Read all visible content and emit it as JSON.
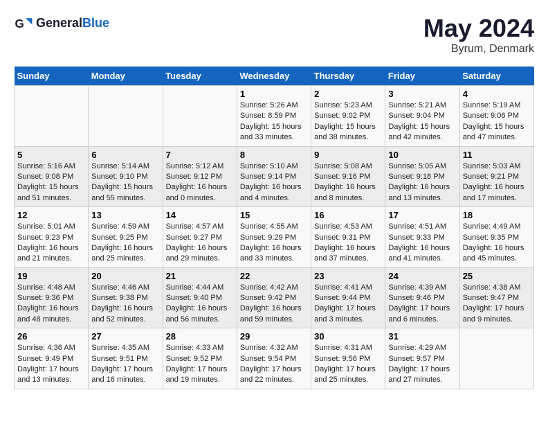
{
  "header": {
    "logo_text_general": "General",
    "logo_text_blue": "Blue",
    "main_title": "May 2024",
    "subtitle": "Byrum, Denmark"
  },
  "days_of_week": [
    "Sunday",
    "Monday",
    "Tuesday",
    "Wednesday",
    "Thursday",
    "Friday",
    "Saturday"
  ],
  "weeks": [
    [
      {
        "day": "",
        "info": ""
      },
      {
        "day": "",
        "info": ""
      },
      {
        "day": "",
        "info": ""
      },
      {
        "day": "1",
        "info": "Sunrise: 5:26 AM\nSunset: 8:59 PM\nDaylight: 15 hours and 33 minutes."
      },
      {
        "day": "2",
        "info": "Sunrise: 5:23 AM\nSunset: 9:02 PM\nDaylight: 15 hours and 38 minutes."
      },
      {
        "day": "3",
        "info": "Sunrise: 5:21 AM\nSunset: 9:04 PM\nDaylight: 15 hours and 42 minutes."
      },
      {
        "day": "4",
        "info": "Sunrise: 5:19 AM\nSunset: 9:06 PM\nDaylight: 15 hours and 47 minutes."
      }
    ],
    [
      {
        "day": "5",
        "info": "Sunrise: 5:16 AM\nSunset: 9:08 PM\nDaylight: 15 hours and 51 minutes."
      },
      {
        "day": "6",
        "info": "Sunrise: 5:14 AM\nSunset: 9:10 PM\nDaylight: 15 hours and 55 minutes."
      },
      {
        "day": "7",
        "info": "Sunrise: 5:12 AM\nSunset: 9:12 PM\nDaylight: 16 hours and 0 minutes."
      },
      {
        "day": "8",
        "info": "Sunrise: 5:10 AM\nSunset: 9:14 PM\nDaylight: 16 hours and 4 minutes."
      },
      {
        "day": "9",
        "info": "Sunrise: 5:08 AM\nSunset: 9:16 PM\nDaylight: 16 hours and 8 minutes."
      },
      {
        "day": "10",
        "info": "Sunrise: 5:05 AM\nSunset: 9:18 PM\nDaylight: 16 hours and 13 minutes."
      },
      {
        "day": "11",
        "info": "Sunrise: 5:03 AM\nSunset: 9:21 PM\nDaylight: 16 hours and 17 minutes."
      }
    ],
    [
      {
        "day": "12",
        "info": "Sunrise: 5:01 AM\nSunset: 9:23 PM\nDaylight: 16 hours and 21 minutes."
      },
      {
        "day": "13",
        "info": "Sunrise: 4:59 AM\nSunset: 9:25 PM\nDaylight: 16 hours and 25 minutes."
      },
      {
        "day": "14",
        "info": "Sunrise: 4:57 AM\nSunset: 9:27 PM\nDaylight: 16 hours and 29 minutes."
      },
      {
        "day": "15",
        "info": "Sunrise: 4:55 AM\nSunset: 9:29 PM\nDaylight: 16 hours and 33 minutes."
      },
      {
        "day": "16",
        "info": "Sunrise: 4:53 AM\nSunset: 9:31 PM\nDaylight: 16 hours and 37 minutes."
      },
      {
        "day": "17",
        "info": "Sunrise: 4:51 AM\nSunset: 9:33 PM\nDaylight: 16 hours and 41 minutes."
      },
      {
        "day": "18",
        "info": "Sunrise: 4:49 AM\nSunset: 9:35 PM\nDaylight: 16 hours and 45 minutes."
      }
    ],
    [
      {
        "day": "19",
        "info": "Sunrise: 4:48 AM\nSunset: 9:36 PM\nDaylight: 16 hours and 48 minutes."
      },
      {
        "day": "20",
        "info": "Sunrise: 4:46 AM\nSunset: 9:38 PM\nDaylight: 16 hours and 52 minutes."
      },
      {
        "day": "21",
        "info": "Sunrise: 4:44 AM\nSunset: 9:40 PM\nDaylight: 16 hours and 56 minutes."
      },
      {
        "day": "22",
        "info": "Sunrise: 4:42 AM\nSunset: 9:42 PM\nDaylight: 16 hours and 59 minutes."
      },
      {
        "day": "23",
        "info": "Sunrise: 4:41 AM\nSunset: 9:44 PM\nDaylight: 17 hours and 3 minutes."
      },
      {
        "day": "24",
        "info": "Sunrise: 4:39 AM\nSunset: 9:46 PM\nDaylight: 17 hours and 6 minutes."
      },
      {
        "day": "25",
        "info": "Sunrise: 4:38 AM\nSunset: 9:47 PM\nDaylight: 17 hours and 9 minutes."
      }
    ],
    [
      {
        "day": "26",
        "info": "Sunrise: 4:36 AM\nSunset: 9:49 PM\nDaylight: 17 hours and 13 minutes."
      },
      {
        "day": "27",
        "info": "Sunrise: 4:35 AM\nSunset: 9:51 PM\nDaylight: 17 hours and 16 minutes."
      },
      {
        "day": "28",
        "info": "Sunrise: 4:33 AM\nSunset: 9:52 PM\nDaylight: 17 hours and 19 minutes."
      },
      {
        "day": "29",
        "info": "Sunrise: 4:32 AM\nSunset: 9:54 PM\nDaylight: 17 hours and 22 minutes."
      },
      {
        "day": "30",
        "info": "Sunrise: 4:31 AM\nSunset: 9:56 PM\nDaylight: 17 hours and 25 minutes."
      },
      {
        "day": "31",
        "info": "Sunrise: 4:29 AM\nSunset: 9:57 PM\nDaylight: 17 hours and 27 minutes."
      },
      {
        "day": "",
        "info": ""
      }
    ]
  ]
}
